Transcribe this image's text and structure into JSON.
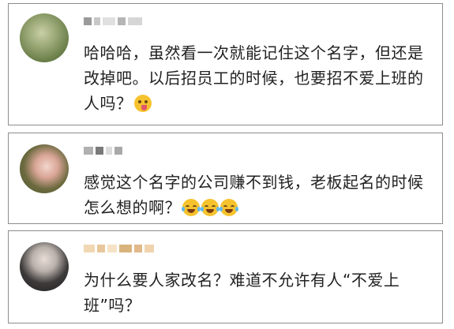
{
  "comments": [
    {
      "text": "哈哈哈，虽然看一次就能记住这个名字，但还是改掉吧。以后招员工的时候，也要招不爱上班的人吗？",
      "emoji": "yum-face-icon"
    },
    {
      "text": "感觉这个名字的公司赚不到钱，老板起名的时候怎么想的啊？",
      "emoji": "tears-of-joy-icon"
    },
    {
      "text": "为什么要人家改名？难道不允许有人“不爱上班”吗？",
      "emoji": ""
    }
  ]
}
